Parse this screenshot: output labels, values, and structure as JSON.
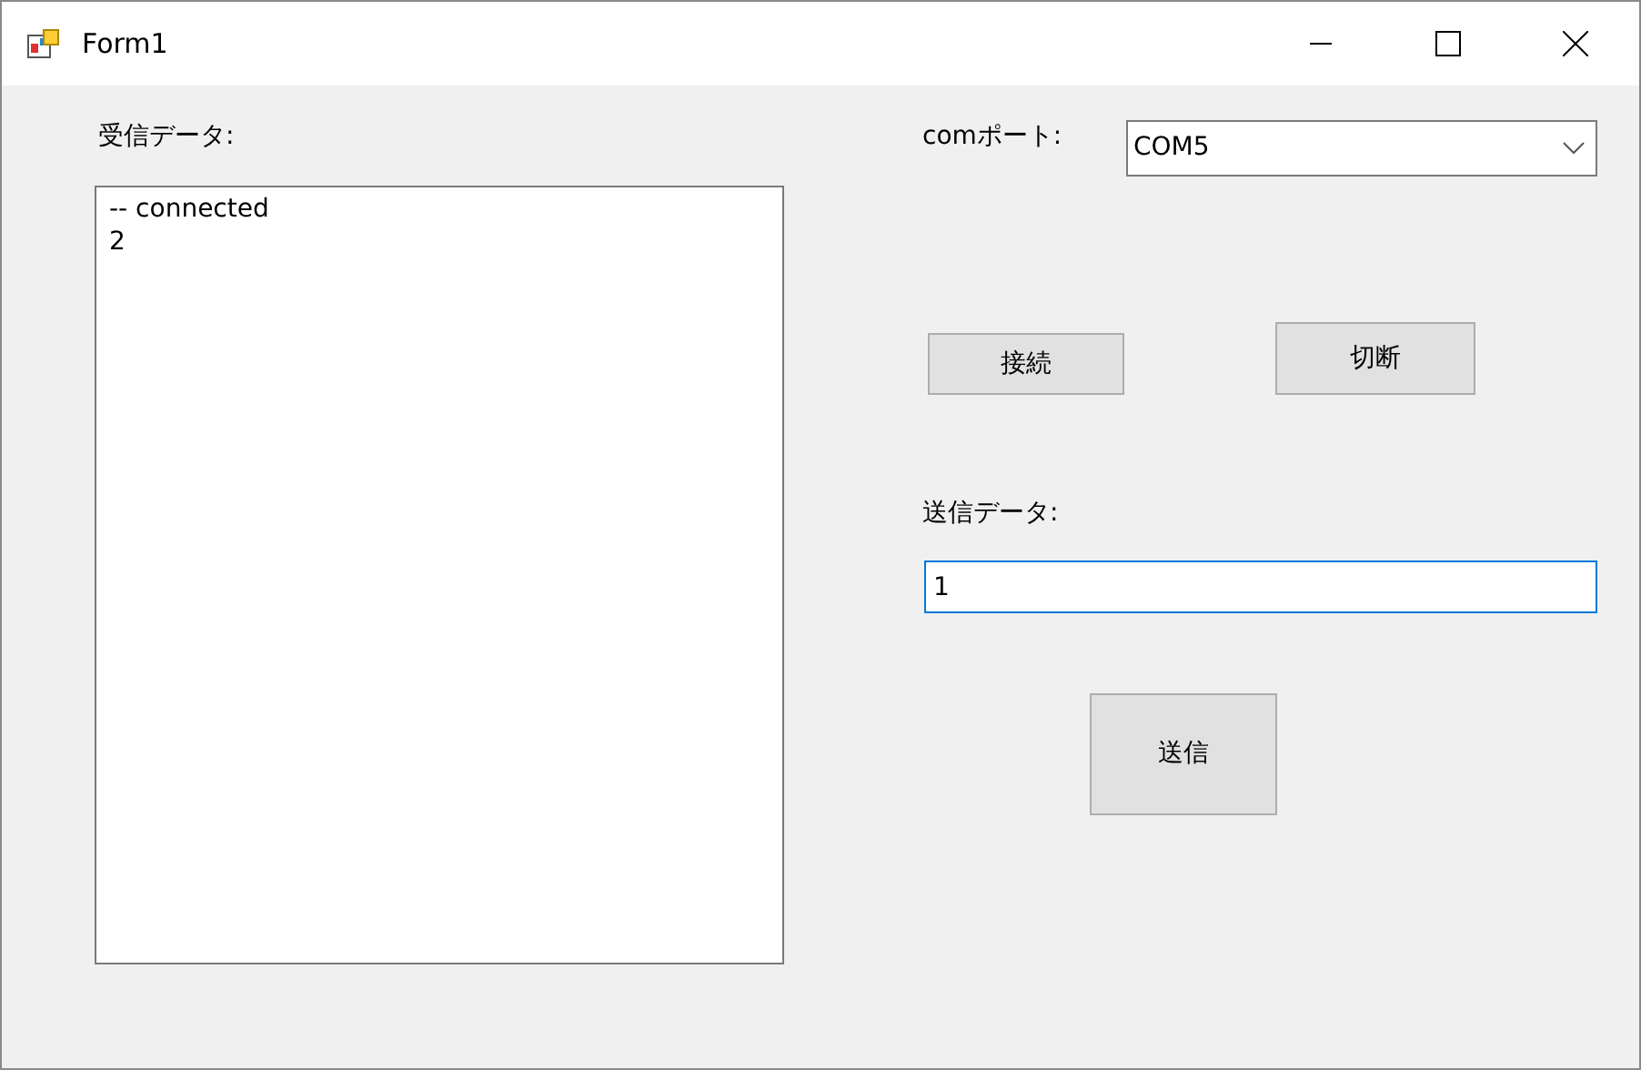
{
  "window": {
    "title": "Form1"
  },
  "received": {
    "label": "受信データ:",
    "lines": [
      "-- connected",
      "2"
    ]
  },
  "port": {
    "label": "comポート:",
    "value": "COM5"
  },
  "buttons": [
    {
      "kind": "connect",
      "label": "接続"
    },
    {
      "kind": "disconnect",
      "label": "切断"
    }
  ],
  "send": {
    "label": "送信データ:",
    "value": "1",
    "focused": true,
    "button": "送信"
  }
}
